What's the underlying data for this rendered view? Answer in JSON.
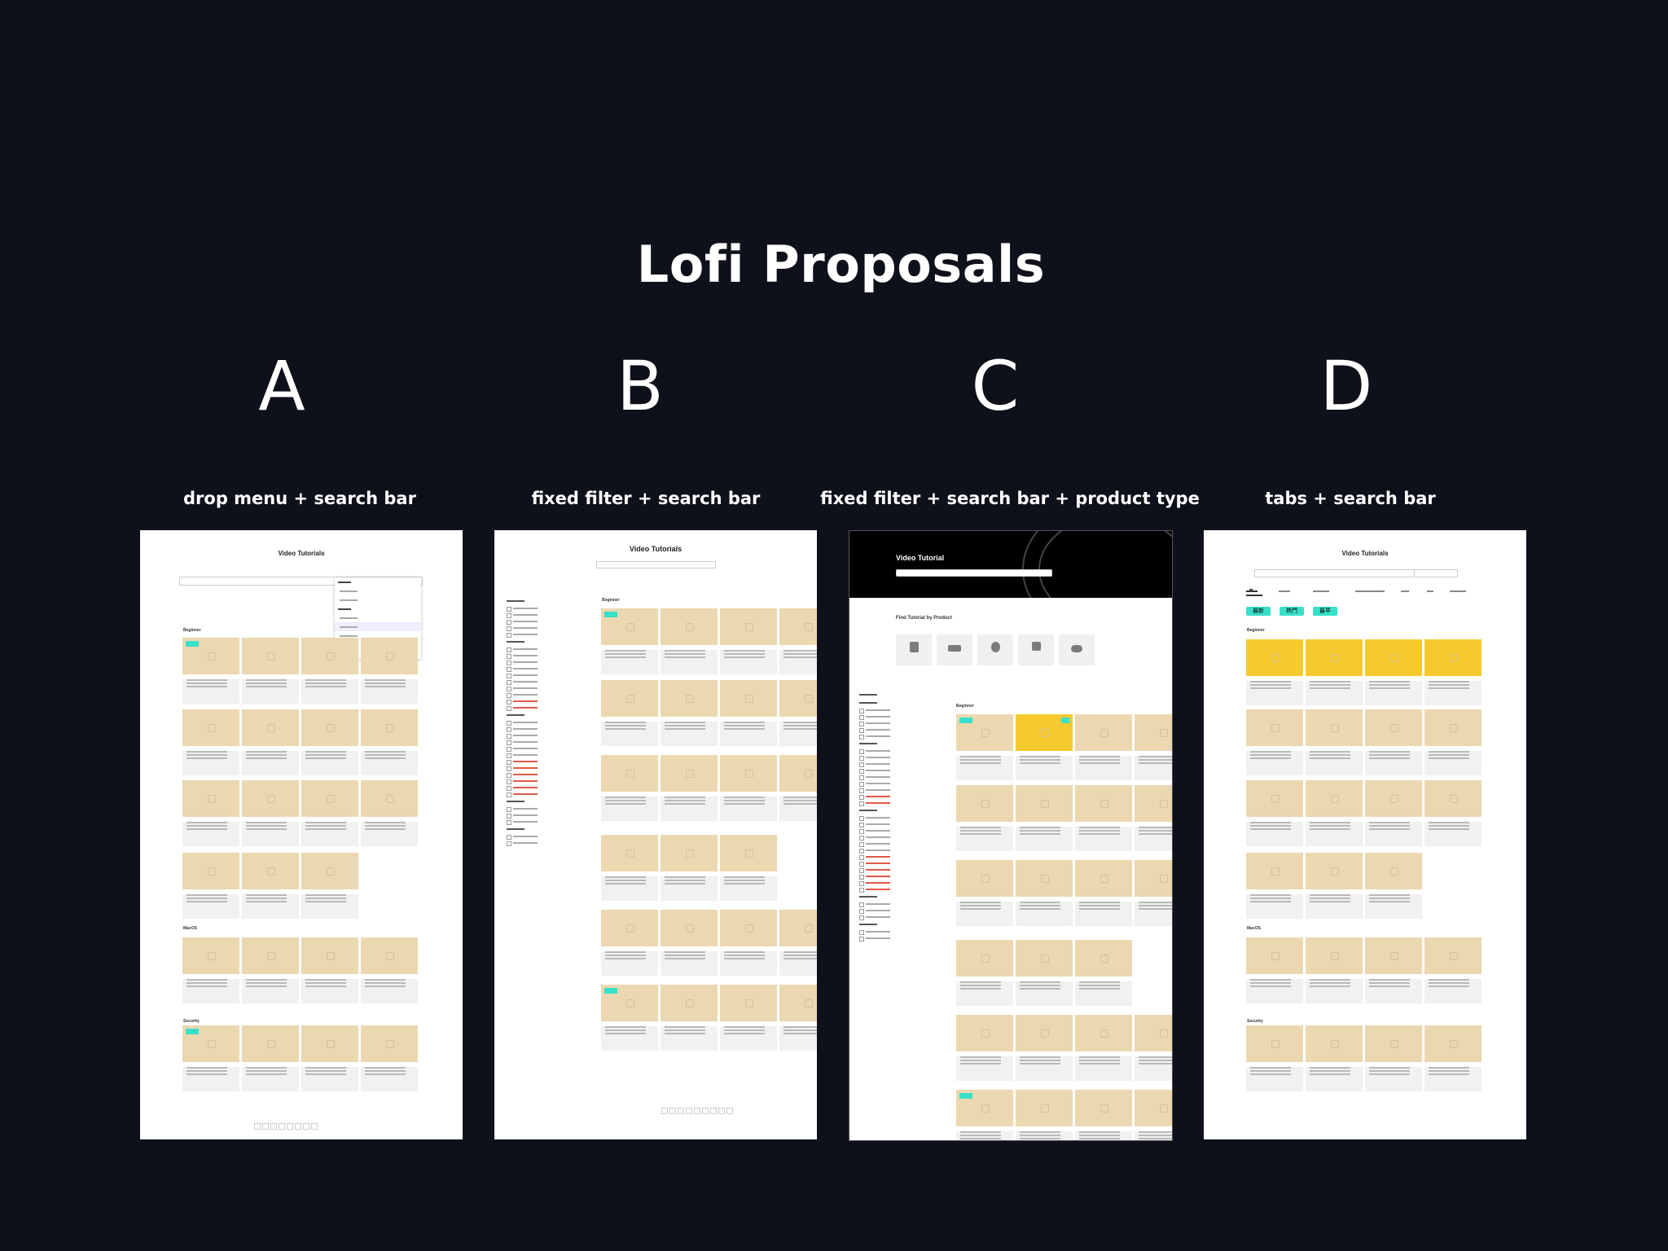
{
  "page": {
    "title": "Lofi Proposals"
  },
  "proposals": [
    {
      "letter": "A",
      "subtitle": "drop menu + search bar",
      "panel_title": "Video Tutorials"
    },
    {
      "letter": "B",
      "subtitle": "fixed filter  + search bar",
      "panel_title": "Video Tutorials"
    },
    {
      "letter": "C",
      "subtitle": "fixed filter  + search bar + product type",
      "panel_title": "Video Tutorial",
      "section_title": "Find Tutorial by Product"
    },
    {
      "letter": "D",
      "subtitle": "tabs  + search bar",
      "panel_title": "Video Tutorials",
      "badges": [
        "最新",
        "熱門",
        "最早"
      ]
    }
  ],
  "sections": {
    "beginner": "Beginner",
    "macos": "MacOS",
    "security": "Security"
  }
}
